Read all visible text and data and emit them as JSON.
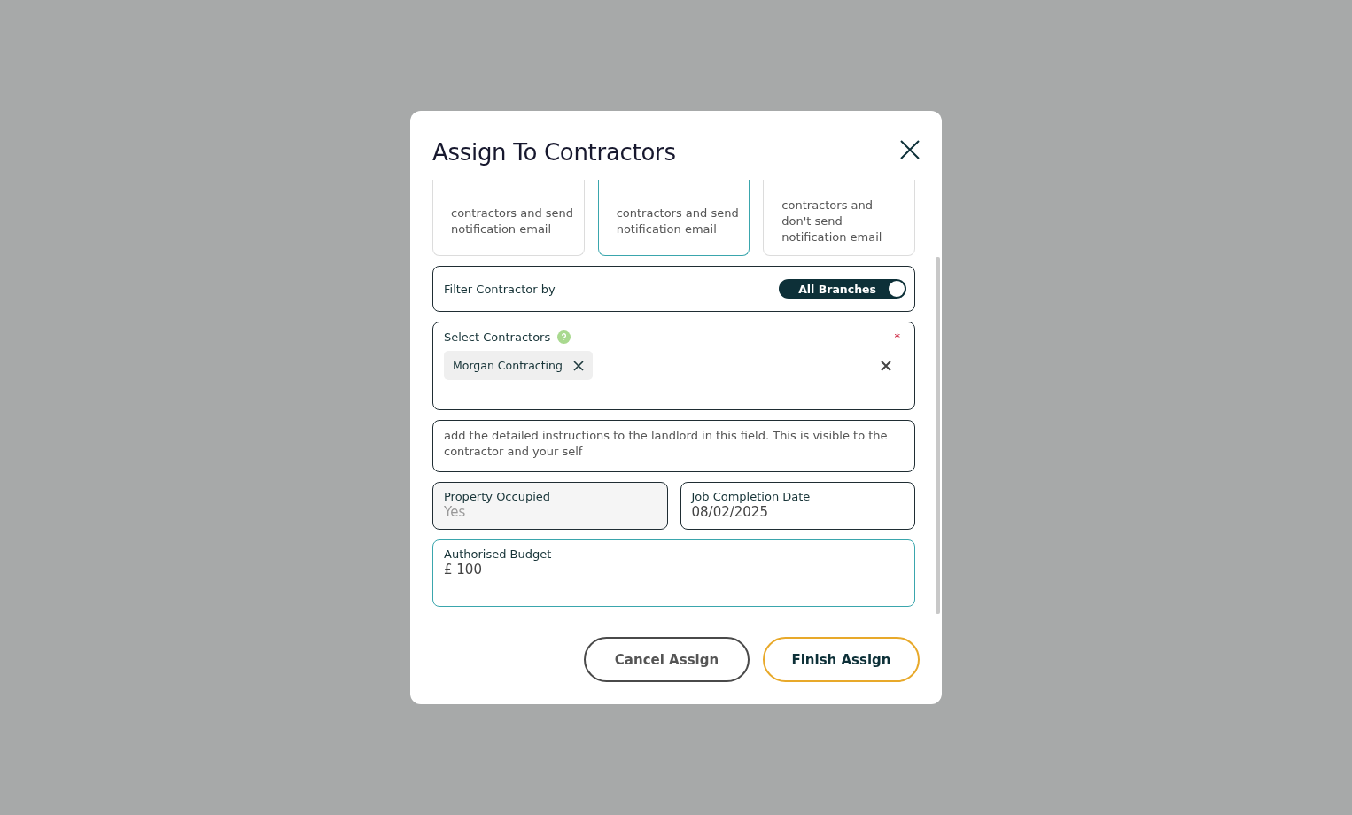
{
  "dialog": {
    "title": "Assign To Contractors",
    "options": [
      {
        "text": "contractors and send notification email",
        "selected": false
      },
      {
        "text": "contractors and send notification email",
        "selected": true
      },
      {
        "text": "contractors and don't send notification email",
        "selected": false
      }
    ],
    "filter": {
      "label": "Filter Contractor by",
      "toggle_label": "All Branches",
      "on": true
    },
    "select": {
      "label": "Select Contractors",
      "required_mark": "*",
      "chips": [
        "Morgan Contracting"
      ]
    },
    "instructions": {
      "placeholder": "add the detailed instructions to the landlord in this field. This is visible to the contractor and your self"
    },
    "fields": [
      {
        "label": "Property Occupied",
        "value": "Yes",
        "disabled": true,
        "focused": false
      },
      {
        "label": "Job Completion Date",
        "value": "08/02/2025",
        "disabled": false,
        "focused": false
      }
    ],
    "budget": {
      "label": "Authorised Budget",
      "value": "£ 100",
      "disabled": false,
      "focused": true
    },
    "buttons": [
      {
        "label": "Cancel Assign",
        "kind": "secondary"
      },
      {
        "label": "Finish Assign",
        "kind": "primary"
      }
    ]
  }
}
